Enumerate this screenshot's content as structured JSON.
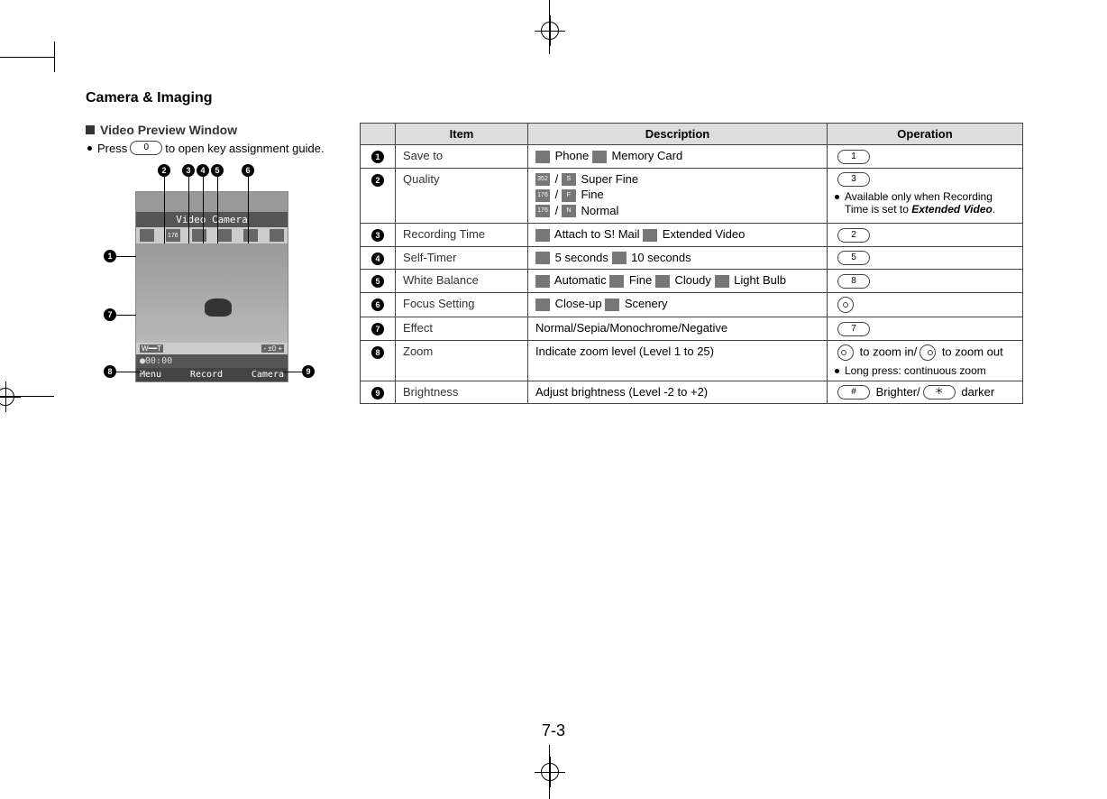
{
  "section_title": "Camera & Imaging",
  "sub_heading": "Video Preview Window",
  "press_line_pre": "Press",
  "press_line_key": "0",
  "press_line_post": "to open key assignment guide.",
  "screenshot": {
    "title": "Video Camera",
    "time": "●00:00",
    "softkeys": [
      "Menu",
      "Record",
      "Camera"
    ]
  },
  "table": {
    "headers": [
      "",
      "Item",
      "Description",
      "Operation"
    ],
    "rows": [
      {
        "n": "1",
        "item": "Save to",
        "desc_parts": [
          {
            "icon": true,
            "label": "Phone"
          },
          {
            "icon": true,
            "label": "Memory Card"
          }
        ],
        "op_key": "1"
      },
      {
        "n": "2",
        "item": "Quality",
        "desc_lines": [
          [
            {
              "icon2": "352 288"
            },
            {
              "sep": "/"
            },
            {
              "icon2": "S FINE"
            },
            {
              "text": "Super Fine"
            }
          ],
          [
            {
              "icon2": "176 144"
            },
            {
              "sep": "/"
            },
            {
              "icon2": "F INE"
            },
            {
              "text": "Fine"
            }
          ],
          [
            {
              "icon2": "176 144"
            },
            {
              "sep": "/"
            },
            {
              "icon2": "N ORMAL"
            },
            {
              "text": "Normal"
            }
          ]
        ],
        "op_key": "3",
        "op_note_pre": "Available only when Recording Time is set to ",
        "op_note_em": "Extended Video",
        "op_note_post": "."
      },
      {
        "n": "3",
        "item": "Recording Time",
        "desc_parts": [
          {
            "icon": true,
            "label": "Attach to S! Mail"
          },
          {
            "icon": true,
            "label": "Extended Video"
          }
        ],
        "op_key": "2"
      },
      {
        "n": "4",
        "item": "Self-Timer",
        "desc_parts": [
          {
            "icon": true,
            "label": "5 seconds"
          },
          {
            "icon": true,
            "label": "10 seconds"
          }
        ],
        "op_key": "5"
      },
      {
        "n": "5",
        "item": "White Balance",
        "desc_parts": [
          {
            "icon": true,
            "label": "Automatic"
          },
          {
            "icon": true,
            "label": "Fine"
          },
          {
            "icon": true,
            "label": "Cloudy"
          },
          {
            "icon": true,
            "label": "Light Bulb"
          }
        ],
        "op_key": "8"
      },
      {
        "n": "6",
        "item": "Focus Setting",
        "desc_parts": [
          {
            "icon": true,
            "label": "Close-up"
          },
          {
            "icon": true,
            "label": "Scenery"
          }
        ],
        "op_circle": true
      },
      {
        "n": "7",
        "item": "Effect",
        "desc_text": "Normal/Sepia/Monochrome/Negative",
        "op_key": "7"
      },
      {
        "n": "8",
        "item": "Zoom",
        "desc_text": "Indicate zoom level (Level 1 to 25)",
        "op_zoom_in": "to zoom in/",
        "op_zoom_out": "to zoom out",
        "op_note2": "Long press: continuous zoom"
      },
      {
        "n": "9",
        "item": "Brightness",
        "desc_text": "Adjust brightness (Level -2 to +2)",
        "op_bright_key1": "#",
        "op_bright_t1": "Brighter/",
        "op_bright_key2": "＊",
        "op_bright_t2": "darker"
      }
    ]
  },
  "page_number": "7-3"
}
